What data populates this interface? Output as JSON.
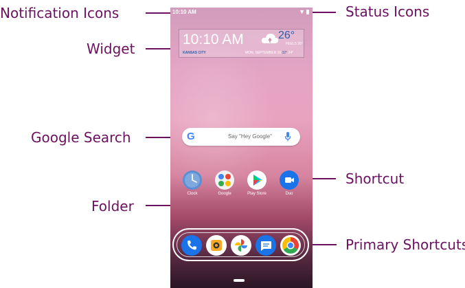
{
  "callouts": {
    "notification_icons": "Notification Icons",
    "widget": "Widget",
    "google_search": "Google Search",
    "folder": "Folder",
    "status_icons": "Status Icons",
    "shortcut": "Shortcut",
    "primary_shortcuts": "Primary Shortcuts"
  },
  "status_bar": {
    "time": "10:10 AM"
  },
  "widget": {
    "time": "10:10 AM",
    "temperature": "26°",
    "feels": "FEELS 26°",
    "city": "KANSAS CITY",
    "date": "MON, SEPTEMBER 16",
    "high": "32°",
    "low": "24°"
  },
  "search": {
    "logo": "G",
    "hint": "Say \"Hey Google\""
  },
  "apps": [
    {
      "label": "Clock",
      "icon": "clock-icon"
    },
    {
      "label": "Google",
      "icon": "google-folder-icon"
    },
    {
      "label": "Play Store",
      "icon": "play-store-icon"
    },
    {
      "label": "Duo",
      "icon": "duo-icon"
    }
  ],
  "dock": [
    "phone-icon",
    "camera-icon",
    "photos-icon",
    "messages-icon",
    "chrome-icon"
  ],
  "colors": {
    "callout": "#6b1160"
  }
}
